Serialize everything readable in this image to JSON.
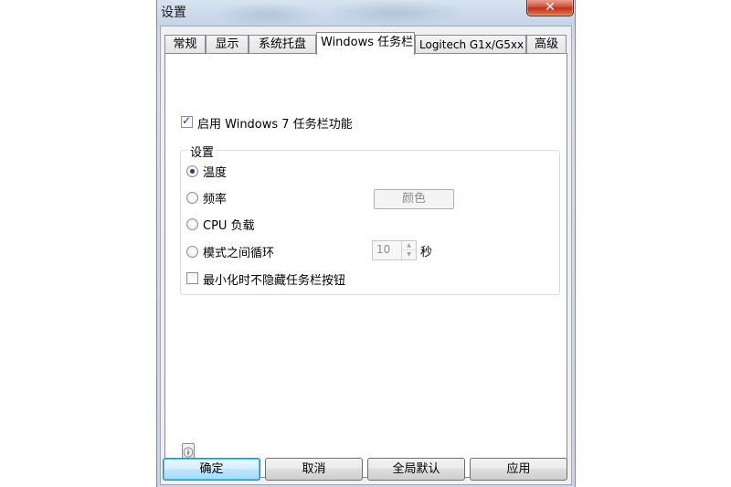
{
  "window": {
    "title": "设置",
    "close_label": "✕"
  },
  "tabs": [
    {
      "label": "常规",
      "active": false
    },
    {
      "label": "显示",
      "active": false
    },
    {
      "label": "系统托盘",
      "active": false
    },
    {
      "label": "Windows 任务栏",
      "active": true
    },
    {
      "label": "Logitech G1x/G5xx",
      "active": false
    },
    {
      "label": "高级",
      "active": false
    }
  ],
  "panel": {
    "enable_checkbox": {
      "label": "启用 Windows 7 任务栏功能",
      "checked": true
    },
    "settings_group": {
      "title": "设置",
      "radios": [
        {
          "label": "温度",
          "checked": true
        },
        {
          "label": "频率",
          "checked": false
        },
        {
          "label": "CPU 负载",
          "checked": false
        },
        {
          "label": "模式之间循环",
          "checked": false
        }
      ],
      "color_button": "颜色",
      "cycle_interval": {
        "value": "10",
        "unit": "秒"
      },
      "hide_checkbox": {
        "label": "最小化时不隐藏任务栏按钮",
        "checked": false
      }
    },
    "small_button_icon": "ⓘ"
  },
  "footer": {
    "ok": "确定",
    "cancel": "取消",
    "defaults": "全局默认",
    "apply": "应用"
  }
}
